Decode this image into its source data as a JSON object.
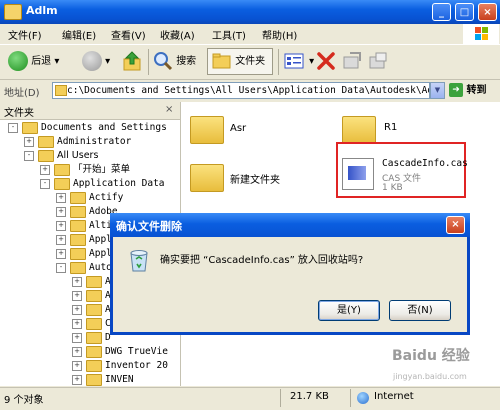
{
  "window": {
    "title": "Adlm"
  },
  "menu": [
    {
      "label": "文件(F)"
    },
    {
      "label": "编辑(E)"
    },
    {
      "label": "查看(V)"
    },
    {
      "label": "收藏(A)"
    },
    {
      "label": "工具(T)"
    },
    {
      "label": "帮助(H)"
    }
  ],
  "toolbar": {
    "back": "后退",
    "search": "搜索",
    "folders": "文件夹"
  },
  "address": {
    "label": "地址(D)",
    "value": "c:\\Documents and Settings\\All Users\\Application Data\\Autodesk\\Adlm",
    "go": "转到"
  },
  "folders_pane": {
    "title": "文件夹",
    "close": "×"
  },
  "tree": [
    {
      "label": "Documents and Settings",
      "level": 0,
      "pm": "-",
      "mono": true
    },
    {
      "label": "Administrator",
      "level": 1,
      "pm": "+",
      "mono": true
    },
    {
      "label": "All Users",
      "level": 1,
      "pm": "-",
      "mono": false
    },
    {
      "label": "「开始」菜单",
      "level": 2,
      "pm": "+",
      "mono": false
    },
    {
      "label": "Application Data",
      "level": 2,
      "pm": "-",
      "mono": true
    },
    {
      "label": "Actify",
      "level": 3,
      "pm": "+",
      "mono": true
    },
    {
      "label": "Adobe",
      "level": 3,
      "pm": "+",
      "mono": true
    },
    {
      "label": "Alti",
      "level": 3,
      "pm": "+",
      "mono": true
    },
    {
      "label": "Appl",
      "level": 3,
      "pm": "+",
      "mono": true
    },
    {
      "label": "Appl",
      "level": 3,
      "pm": "+",
      "mono": true
    },
    {
      "label": "Auto",
      "level": 3,
      "pm": "-",
      "mono": true
    },
    {
      "label": "A",
      "level": 4,
      "pm": "+",
      "mono": true
    },
    {
      "label": "A",
      "level": 4,
      "pm": "+",
      "mono": true
    },
    {
      "label": "A",
      "level": 4,
      "pm": "+",
      "mono": true
    },
    {
      "label": "C",
      "level": 4,
      "pm": "+",
      "mono": true
    },
    {
      "label": "D",
      "level": 4,
      "pm": "+",
      "mono": true
    },
    {
      "label": "DWG TrueVie",
      "level": 4,
      "pm": "+",
      "mono": true
    },
    {
      "label": "Inventor 20",
      "level": 4,
      "pm": "+",
      "mono": true
    },
    {
      "label": "INVEN",
      "level": 4,
      "pm": "+",
      "mono": true
    }
  ],
  "files": {
    "asr": "Asr",
    "r1": "R1",
    "new_folder": "新建文件夹",
    "cas_name": "CascadeInfo.cas",
    "cas_type": "CAS 文件",
    "cas_size": "1 KB"
  },
  "dialog": {
    "title": "确认文件删除",
    "close": "×",
    "message": "确实要把 “CascadeInfo.cas” 放入回收站吗?",
    "yes": "是(Y)",
    "no": "否(N)"
  },
  "status": {
    "objects": "9 个对象",
    "size": "21.7 KB",
    "zone": "Internet"
  },
  "watermark": {
    "main": "Baidu 经验",
    "sub": "jingyan.baidu.com"
  },
  "colors": {
    "titlebar": "#0A5EE0",
    "highlight_box": "#E02424"
  }
}
